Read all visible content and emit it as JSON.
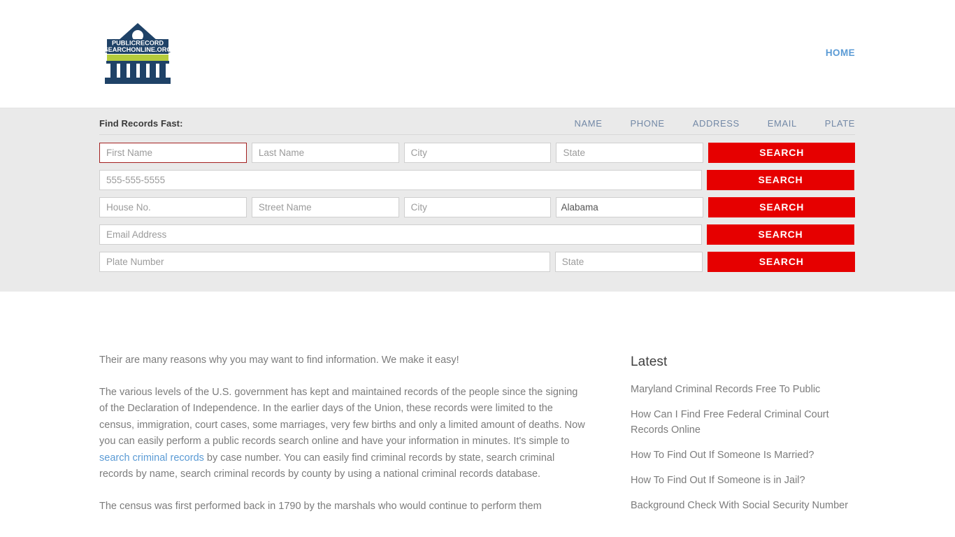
{
  "header": {
    "logo": {
      "name": "public-record-search-online-logo",
      "line1": "PUBLICRECORD",
      "line2": "SEARCHONLINE.ORG",
      "navy": "#1f4267",
      "olive": "#b5cc3c"
    },
    "nav": [
      {
        "label": "HOME",
        "name": "nav-link-home"
      }
    ]
  },
  "search_panel": {
    "title": "Find Records Fast:",
    "tabs": [
      {
        "label": "NAME",
        "name": "tab-name"
      },
      {
        "label": "PHONE",
        "name": "tab-phone"
      },
      {
        "label": "ADDRESS",
        "name": "tab-address"
      },
      {
        "label": "EMAIL",
        "name": "tab-email"
      },
      {
        "label": "PLATE",
        "name": "tab-plate"
      }
    ],
    "button_label": "SEARCH",
    "accent_color": "#e60000",
    "focus_border_color": "#a32020",
    "rows": {
      "name": {
        "first_name_placeholder": "First Name",
        "last_name_placeholder": "Last Name",
        "city_placeholder": "City",
        "state_placeholder": "State"
      },
      "phone": {
        "phone_placeholder": "555-555-5555"
      },
      "address": {
        "house_no_placeholder": "House No.",
        "street_name_placeholder": "Street Name",
        "city_placeholder": "City",
        "state_value": "Alabama"
      },
      "email": {
        "email_placeholder": "Email Address"
      },
      "plate": {
        "plate_placeholder": "Plate Number",
        "state_placeholder": "State"
      }
    }
  },
  "content": {
    "paragraphs": {
      "p1": "Their are many reasons why you may want to find information. We make it easy!",
      "p2_before_link": "The various levels of the U.S. government has kept and maintained records of the people since the signing of the Declaration of Independence. In the earlier days of the Union, these records were limited to the census, immigration, court cases, some marriages, very few births and only a limited amount of deaths. Now you can easily perform a public records search online and have your information in minutes. It's simple to ",
      "p2_link": "search criminal records",
      "p2_after_link": " by case number. You can easily find criminal records by state, search criminal records by name, search criminal records by county by using a national criminal records database.",
      "p3": "The census was first performed back in 1790 by the marshals who would continue to perform them"
    }
  },
  "sidebar": {
    "title": "Latest",
    "items": [
      {
        "label": "Maryland Criminal Records Free To Public"
      },
      {
        "label": "How Can I Find Free Federal Criminal Court Records Online"
      },
      {
        "label": "How To Find Out If Someone Is Married?"
      },
      {
        "label": "How To Find Out If Someone is in Jail?"
      },
      {
        "label": "Background Check With Social Security Number"
      }
    ]
  }
}
